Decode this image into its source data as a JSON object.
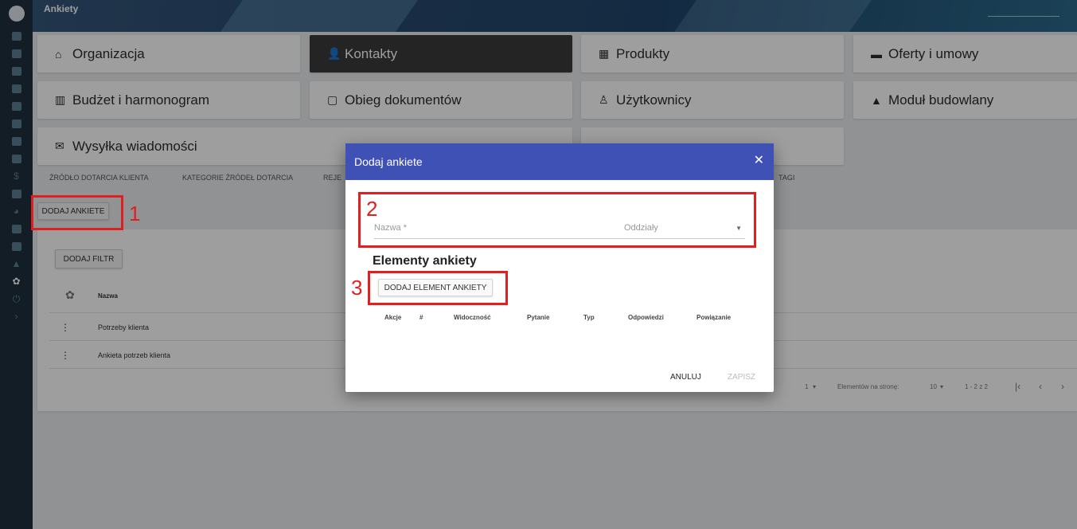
{
  "app": {
    "title": "Ankiety"
  },
  "rail": {
    "icons": [
      "logo-icon",
      "dashboard-icon",
      "calendar-icon",
      "people-icon",
      "building-icon",
      "store-icon",
      "briefcase-icon",
      "folder-icon",
      "inbox-icon",
      "dollar-icon",
      "document-icon",
      "pie-chart-icon",
      "bar-chart-icon",
      "card-icon",
      "warning-icon",
      "settings-icon",
      "power-icon",
      "chevron-right-icon"
    ]
  },
  "tiles": [
    {
      "label": "Organizacja",
      "icon": "⌂"
    },
    {
      "label": "Kontakty",
      "icon": "👤"
    },
    {
      "label": "Produkty",
      "icon": "▦"
    },
    {
      "label": "Oferty i umowy",
      "icon": "▬"
    },
    {
      "label": "Budżet i harmonogram",
      "icon": "▥"
    },
    {
      "label": "Obieg dokumentów",
      "icon": "▢"
    },
    {
      "label": "Użytkownicy",
      "icon": "♙"
    },
    {
      "label": "Moduł budowlany",
      "icon": "▲"
    },
    {
      "label": "Wysyłka wiadomości",
      "icon": "✉"
    }
  ],
  "subtabs": [
    "ŹRÓDŁO DOTARCIA KLIENTA",
    "KATEGORIE ŹRÓDEŁ DOTARCIA",
    "REJE",
    "TAGI"
  ],
  "toolbar": {
    "add_survey": "DODAJ ANKIETE",
    "add_filter": "DODAJ FILTR"
  },
  "table": {
    "header": "Nazwa",
    "rows": [
      "Potrzeby klienta",
      "Ankieta potrzeb klienta"
    ]
  },
  "pager": {
    "page": "1",
    "per_page_label": "Elementów na stronę:",
    "per_page": "10",
    "range": "1 - 2 z 2"
  },
  "dialog": {
    "title": "Dodaj ankiete",
    "name_placeholder": "Nazwa *",
    "branch_placeholder": "Oddziały",
    "section_title": "Elementy ankiety",
    "add_element": "DODAJ ELEMENT ANKIETY",
    "columns": [
      "Akcje",
      "#",
      "Widoczność",
      "Pytanie",
      "Typ",
      "Odpowiedzi",
      "Powiązanie"
    ],
    "cancel": "ANULUJ",
    "save": "ZAPISZ"
  },
  "annotations": [
    "1",
    "2",
    "3"
  ],
  "colors": {
    "dialog_header": "#3f51b5",
    "annotation": "#e02020",
    "rail": "#1f2f3d"
  }
}
